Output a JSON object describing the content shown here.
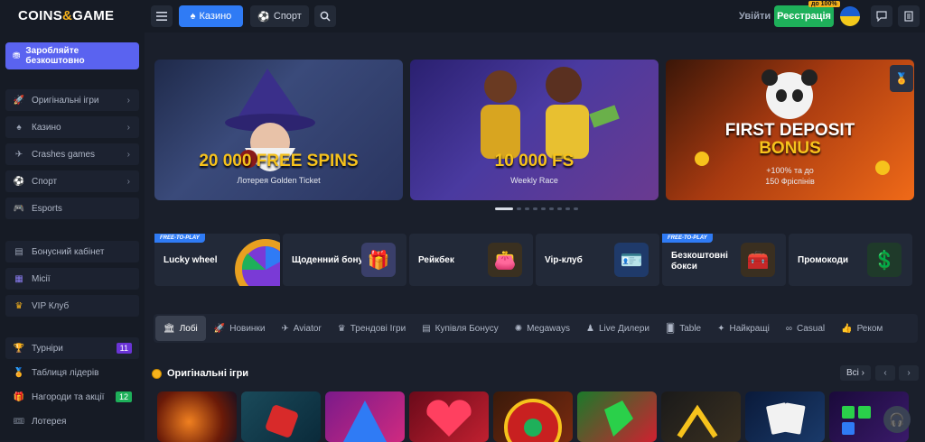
{
  "header": {
    "logo_left": "COINS",
    "logo_mid": "&",
    "logo_right": "GAME",
    "casino_label": "Казино",
    "sport_label": "Спорт",
    "login_label": "Увійти",
    "register_label": "Реєстрація",
    "register_badge": "до 100%"
  },
  "sidebar": {
    "earn_label": "Заробляйте безкоштовно",
    "items": [
      {
        "label": "Оригінальні ігри",
        "icon": "rocket-icon"
      },
      {
        "label": "Казино",
        "icon": "spade-icon"
      },
      {
        "label": "Crashes games",
        "icon": "crash-icon"
      },
      {
        "label": "Спорт",
        "icon": "ball-icon"
      },
      {
        "label": "Esports",
        "icon": "gamepad-icon"
      }
    ],
    "items2": [
      {
        "label": "Бонусний кабінет",
        "icon": "gift-icon"
      },
      {
        "label": "Місії",
        "icon": "grid-icon"
      },
      {
        "label": "VIP Клуб",
        "icon": "crown-icon"
      }
    ],
    "items3": [
      {
        "label": "Турніри",
        "count": "11",
        "count_color": "#6a34d6"
      },
      {
        "label": "Таблиця лідерів"
      },
      {
        "label": "Нагороди та акції",
        "count": "12",
        "count_color": "#1eb05a"
      },
      {
        "label": "Лотерея"
      }
    ]
  },
  "banners": [
    {
      "title": "20 000 FREE SPINS",
      "subtitle": "Лотерея Golden Ticket"
    },
    {
      "title": "10 000 FS",
      "subtitle": "Weekly Race"
    },
    {
      "title": "FIRST DEPOSIT",
      "title2": "BONUS",
      "subtitle": "+100% та до",
      "subtitle2": "150 Фріспінів"
    }
  ],
  "promos": [
    {
      "label": "Lucky wheel",
      "badge": "FREE-TO-PLAY"
    },
    {
      "label": "Щоденний бонус"
    },
    {
      "label": "Рейкбек"
    },
    {
      "label": "Vip-клуб"
    },
    {
      "label": "Безкоштовні боксі",
      "label_line1": "Безкоштовні",
      "label_line2": "бокси",
      "badge": "FREE-TO-PLAY"
    },
    {
      "label": "Промокоди"
    }
  ],
  "categories": [
    "Лобі",
    "Новинки",
    "Aviator",
    "Трендові Ігри",
    "Купівля Бонусу",
    "Megaways",
    "Live Дилери",
    "Table",
    "Найкращі",
    "Casual",
    "Реком"
  ],
  "section": {
    "title": "Оригінальні ігри",
    "all_label": "Всі"
  },
  "colors": {
    "accent": "#2f7bf5",
    "register": "#1eb05a",
    "earn": "#5a63f0",
    "gold": "#f6b21c"
  }
}
